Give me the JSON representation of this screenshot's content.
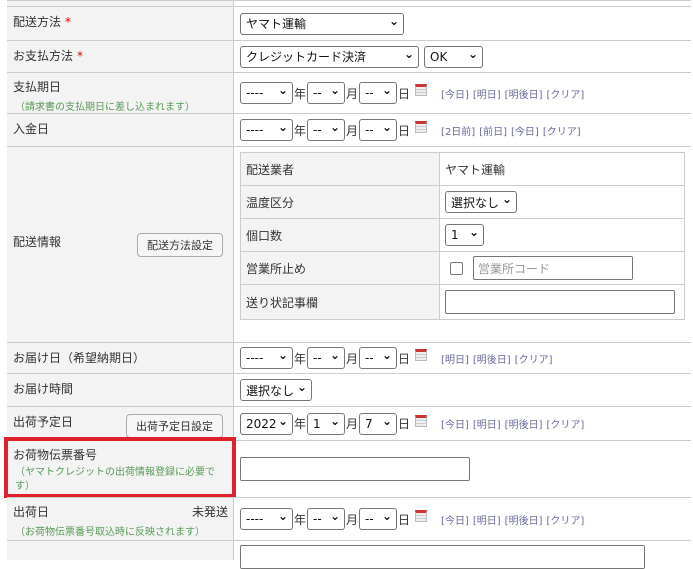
{
  "shipping_method": {
    "label": "配送方法",
    "required": "*",
    "value": "ヤマト運輸"
  },
  "payment_method": {
    "label": "お支払方法",
    "required": "*",
    "value": "クレジットカード決済",
    "status": "OK"
  },
  "payment_due": {
    "label": "支払期日",
    "note": "（請求書の支払期日に差し込まれます）",
    "year": "----",
    "month": "--",
    "day": "--",
    "links": [
      "[今日]",
      "[明日]",
      "[明後日]",
      "[クリア]"
    ]
  },
  "deposit_date": {
    "label": "入金日",
    "year": "----",
    "month": "--",
    "day": "--",
    "links": [
      "[2日前]",
      "[前日]",
      "[今日]",
      "[クリア]"
    ]
  },
  "units": {
    "year": "年",
    "month": "月",
    "day": "日"
  },
  "delivery_info": {
    "label": "配送情報",
    "button": "配送方法設定",
    "carrier_label": "配送業者",
    "carrier": "ヤマト運輸",
    "temp_label": "温度区分",
    "temp": "選択なし",
    "count_label": "個口数",
    "count": "1",
    "office_label": "営業所止め",
    "office_placeholder": "営業所コード",
    "memo_label": "送り状記事欄"
  },
  "delivery_date": {
    "label": "お届け日（希望納期日）",
    "year": "----",
    "month": "--",
    "day": "--",
    "links": [
      "[明日]",
      "[明後日]",
      "[クリア]"
    ]
  },
  "delivery_time": {
    "label": "お届け時間",
    "value": "選択なし"
  },
  "ship_plan": {
    "label": "出荷予定日",
    "button": "出荷予定日設定",
    "year": "2022",
    "month": "1",
    "day": "7",
    "links": [
      "[今日]",
      "[明日]",
      "[明後日]",
      "[クリア]"
    ]
  },
  "tracking": {
    "label": "お荷物伝票番号",
    "note": "（ヤマトクレジットの出荷情報登録に必要です）"
  },
  "ship_date": {
    "label": "出荷日",
    "status": "未発送",
    "note": "（お荷物伝票番号取込時に反映されます）",
    "year": "----",
    "month": "--",
    "day": "--",
    "links": [
      "[今日]",
      "[明日]",
      "[明後日]",
      "[クリア]"
    ]
  }
}
